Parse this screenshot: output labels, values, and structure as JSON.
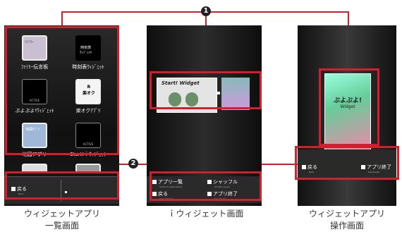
{
  "callouts": {
    "one": "1",
    "two": "2"
  },
  "screen1": {
    "tiles": [
      {
        "label": "ﾌｧﾐﾘｰ伝言板",
        "icon_text": "ﾌｧﾐﾘｰ"
      },
      {
        "label": "時刻表ｳｨｼﾞｪｯﾄ",
        "icon_text": "時刻表\nｳｨｼﾞｪｯﾄ"
      },
      {
        "label": "ぷよぷよ!ｳｨｼﾞｪｯﾄ",
        "icon_text": "ACTIVE"
      },
      {
        "label": "楽オクｱﾌﾟﾘ",
        "icon_text": "R\n楽オク"
      },
      {
        "label": "地図アプリ",
        "icon_text": "地図ｱﾌﾟﾘ"
      },
      {
        "label": "Start!ｉｳｨｼﾞｪｯﾄ",
        "icon_text": "ACTIVE"
      }
    ],
    "softkey_back": "戻る",
    "softkey_back_sub": "Back",
    "caption_line1": "ウィジェットアプリ",
    "caption_line2": "一覧画面"
  },
  "screen2": {
    "widget_title": "Start! Widget",
    "softkeys": [
      {
        "label": "アプリ一覧",
        "sub": "Show All Applications"
      },
      {
        "label": "シャッフル",
        "sub": "Shuffle Layout"
      },
      {
        "label": "戻る",
        "sub": "Quit i-Widget"
      },
      {
        "label": "アプリ終了",
        "sub": "Deactivate"
      }
    ],
    "caption": "ｉウィジェット画面"
  },
  "screen3": {
    "widget_title": "ぷよぷよ!",
    "widget_sub": "Widget",
    "softkeys": [
      {
        "label": "戻る",
        "sub": "Back"
      },
      {
        "label": "アプリ終了",
        "sub": "Deactivate"
      }
    ],
    "caption_line1": "ウィジェットアプリ",
    "caption_line2": "操作画面"
  },
  "colors": {
    "callout_red": "#d21f2c"
  }
}
